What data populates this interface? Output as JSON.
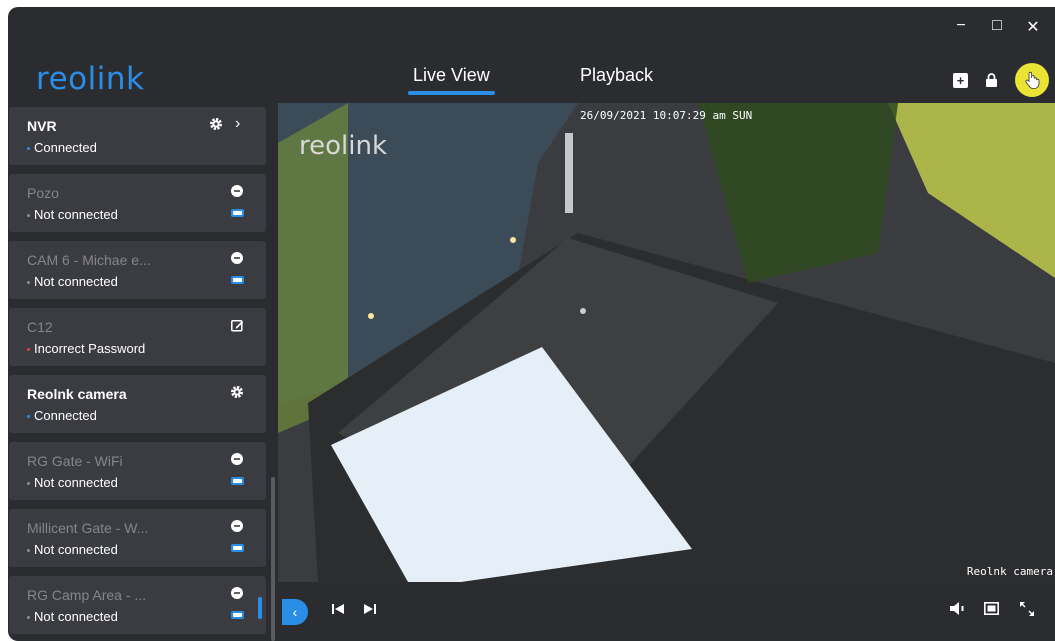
{
  "window": {
    "minimize": "−",
    "maximize": "□",
    "close": "✕"
  },
  "header": {
    "logo": "reolink",
    "tabs": [
      {
        "label": "Live View",
        "active": true
      },
      {
        "label": "Playback",
        "active": false
      }
    ],
    "icons": [
      "add-icon",
      "lock-icon",
      "settings-icon"
    ]
  },
  "sidebar": {
    "devices": [
      {
        "name": "NVR",
        "status": "Connected",
        "status_color": "#2a8ee6",
        "connected": true,
        "icons": [
          "gear-icon",
          "chevron-right-icon"
        ]
      },
      {
        "name": "Pozo",
        "status": "Not connected",
        "status_color": "#8a8b90",
        "connected": false,
        "icons": [
          "info-icon",
          "battery-icon"
        ]
      },
      {
        "name": "CAM 6 - Michae e...",
        "status": "Not connected",
        "status_color": "#8a8b90",
        "connected": false,
        "icons": [
          "info-icon",
          "battery-icon"
        ]
      },
      {
        "name": "C12",
        "status": "Incorrect Password",
        "status_color": "#e04040",
        "connected": false,
        "icons": [
          "edit-icon"
        ]
      },
      {
        "name": "Reolnk camera",
        "status": "Connected",
        "status_color": "#2a8ee6",
        "connected": true,
        "icons": [
          "gear-icon"
        ]
      },
      {
        "name": "RG Gate - WiFi",
        "status": "Not connected",
        "status_color": "#8a8b90",
        "connected": false,
        "icons": [
          "info-icon",
          "battery-icon"
        ]
      },
      {
        "name": "Millicent Gate - W...",
        "status": "Not connected",
        "status_color": "#8a8b90",
        "connected": false,
        "icons": [
          "info-icon",
          "battery-icon"
        ]
      },
      {
        "name": "RG Camp Area - ...",
        "status": "Not connected",
        "status_color": "#8a8b90",
        "connected": false,
        "icons": [
          "info-icon",
          "battery-icon"
        ]
      }
    ]
  },
  "video": {
    "osd_logo": "reolink",
    "osd_timestamp": "26/09/2021 10:07:29 am SUN",
    "osd_camera_name": "Reolnk camera"
  },
  "controls": {
    "left": [
      "collapse-icon",
      "previous-icon",
      "next-icon"
    ],
    "right": [
      "volume-icon",
      "layout-icon",
      "fullscreen-icon"
    ]
  },
  "colors": {
    "accent": "#2a8ee6",
    "background": "#2b2c30",
    "card": "#3b3c41",
    "highlight": "#e8e334"
  }
}
